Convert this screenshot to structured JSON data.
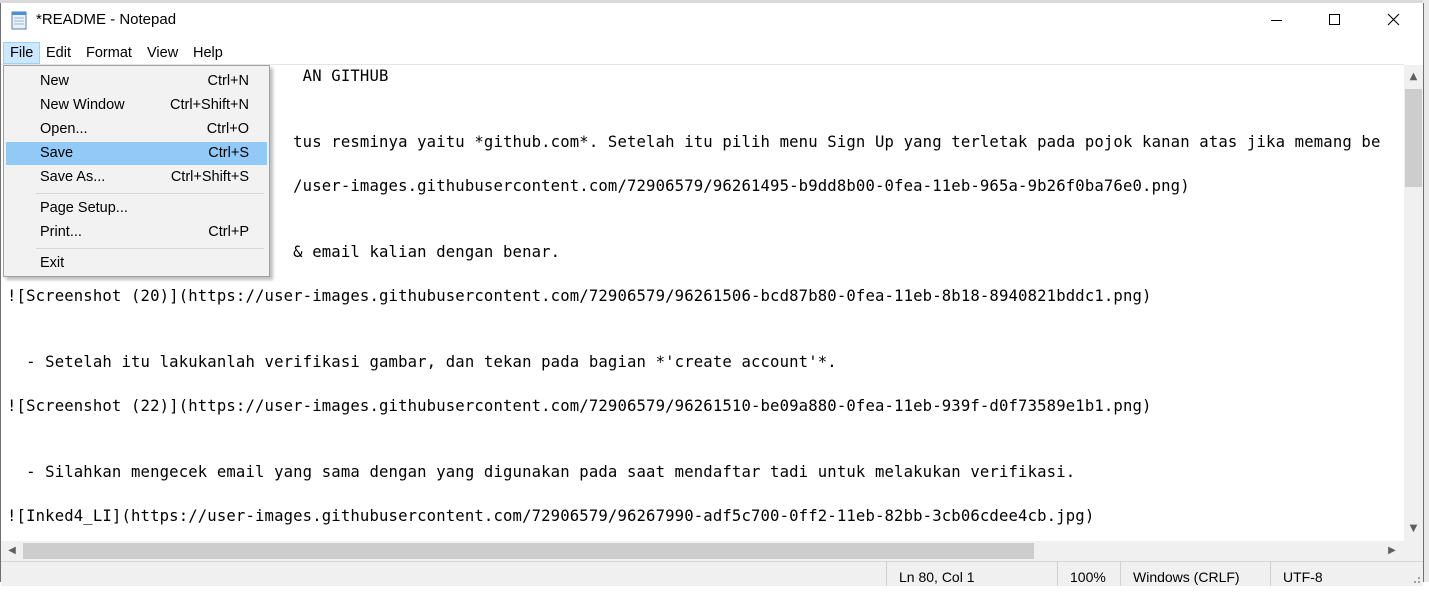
{
  "window": {
    "title": "*README - Notepad",
    "icon": "notepad-icon",
    "controls": [
      "minimize-icon",
      "maximize-icon",
      "close-icon"
    ]
  },
  "menubar": {
    "items": [
      "File",
      "Edit",
      "Format",
      "View",
      "Help"
    ],
    "active": "File"
  },
  "file_menu": {
    "groups": [
      [
        {
          "label": "New",
          "shortcut": "Ctrl+N"
        },
        {
          "label": "New Window",
          "shortcut": "Ctrl+Shift+N"
        },
        {
          "label": "Open...",
          "shortcut": "Ctrl+O"
        },
        {
          "label": "Save",
          "shortcut": "Ctrl+S"
        },
        {
          "label": "Save As...",
          "shortcut": "Ctrl+Shift+S"
        }
      ],
      [
        {
          "label": "Page Setup...",
          "shortcut": ""
        },
        {
          "label": "Print...",
          "shortcut": "Ctrl+P"
        }
      ],
      [
        {
          "label": "Exit",
          "shortcut": ""
        }
      ]
    ],
    "highlighted": "Save"
  },
  "editor": {
    "lines": [
      "                               AN GITHUB",
      "",
      "",
      "                              tus resminya yaitu *github.com*. Setelah itu pilih menu Sign Up yang terletak pada pojok kanan atas jika memang be",
      "",
      "                              /user-images.githubusercontent.com/72906579/96261495-b9dd8b00-0fea-11eb-965a-9b26f0ba76e0.png)",
      "",
      "",
      "                              & email kalian dengan benar.",
      "",
      "![Screenshot (20)](https://user-images.githubusercontent.com/72906579/96261506-bcd87b80-0fea-11eb-8b18-8940821bddc1.png)",
      "",
      "",
      "  - Setelah itu lakukanlah verifikasi gambar, dan tekan pada bagian *'create account'*.",
      "",
      "![Screenshot (22)](https://user-images.githubusercontent.com/72906579/96261510-be09a880-0fea-11eb-939f-d0f73589e1b1.png)",
      "",
      "",
      "  - Silahkan mengecek email yang sama dengan yang digunakan pada saat mendaftar tadi untuk melakukan verifikasi.",
      "",
      "![Inked4_LI](https://user-images.githubusercontent.com/72906579/96267990-adf5c700-0ff2-11eb-82bb-3cb06cdee4cb.jpg)"
    ]
  },
  "statusbar": {
    "position": "Ln 80, Col 1",
    "zoom": "100%",
    "line_ending": "Windows (CRLF)",
    "encoding": "UTF-8"
  }
}
